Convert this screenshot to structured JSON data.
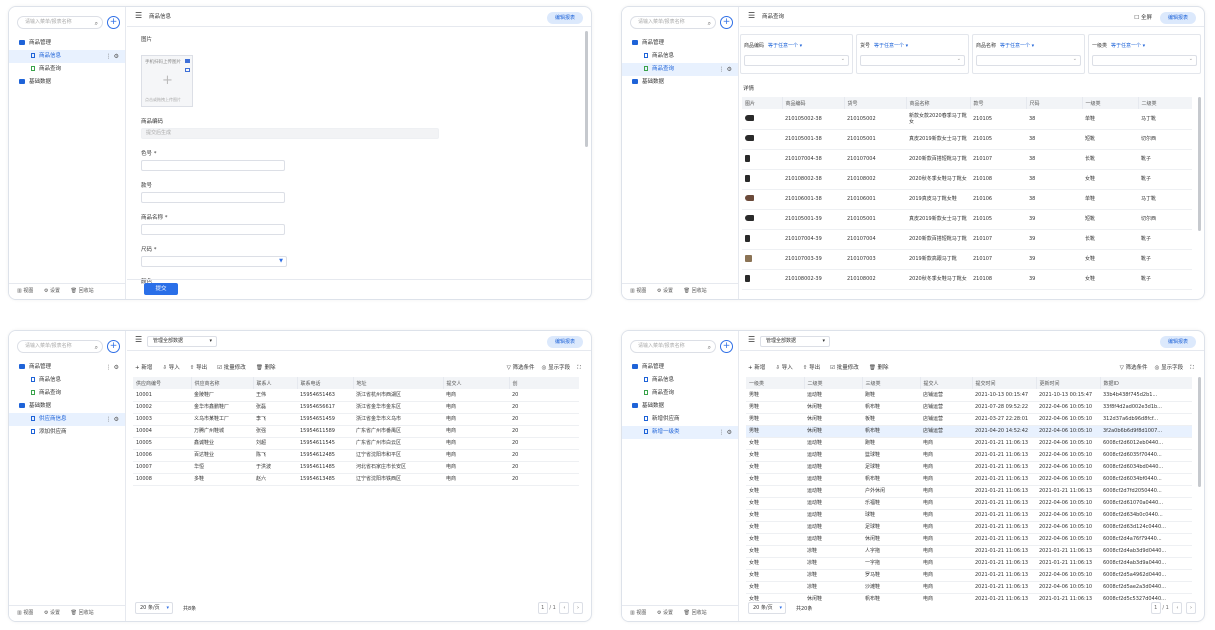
{
  "common": {
    "search_placeholder": "请输入菜单/报表名称",
    "add": "+",
    "footer": [
      "视图",
      "设置",
      "回收站"
    ]
  },
  "p1": {
    "tree": [
      {
        "label": "商品管理",
        "level": 1,
        "icon": "folder"
      },
      {
        "label": "商品信息",
        "level": 2,
        "icon": "doc",
        "selected": true
      },
      {
        "label": "商品查询",
        "level": 2,
        "icon": "doc-green"
      },
      {
        "label": "基础数据",
        "level": 1,
        "icon": "folder"
      }
    ],
    "title": "商品信息",
    "edit_btn": "编辑报表",
    "form": {
      "image_label": "图片",
      "upload_hint1": "手机扫码上传图片",
      "upload_hint2": "点击或拖拽上传图片",
      "code_label": "商品编码",
      "code_placeholder": "提交后生成",
      "color_label": "色号 *",
      "model_label": "款号",
      "name_label": "商品名称 *",
      "size_label": "尺码 *",
      "color2_label": "颜色",
      "submit": "提交"
    }
  },
  "p2": {
    "tree": [
      {
        "label": "商品管理",
        "level": 1,
        "icon": "folder"
      },
      {
        "label": "商品信息",
        "level": 2,
        "icon": "doc"
      },
      {
        "label": "商品查询",
        "level": 2,
        "icon": "doc-green",
        "selected": true
      },
      {
        "label": "基础数据",
        "level": 1,
        "icon": "folder"
      }
    ],
    "title": "商品查询",
    "fullscreen": "全屏",
    "edit_btn": "编辑报表",
    "filters": [
      {
        "name": "商品编码",
        "op": "等于任意一个"
      },
      {
        "name": "货号",
        "op": "等于任意一个"
      },
      {
        "name": "商品名称",
        "op": "等于任意一个"
      },
      {
        "name": "一级类",
        "op": "等于任意一个"
      }
    ],
    "result_label": "详情",
    "columns": [
      "图片",
      "商品编码",
      "货号",
      "商品名称",
      "款号",
      "尺码",
      "一级类",
      "二级类"
    ],
    "rows": [
      [
        "shoe",
        "210105002-38",
        "210105002",
        "新款女款2020春季马丁靴女",
        "210105",
        "38",
        "单鞋",
        "马丁靴"
      ],
      [
        "shoe",
        "210105001-38",
        "210105001",
        "真皮2019新款女士马丁靴",
        "210105",
        "38",
        "短靴",
        "切尔西"
      ],
      [
        "boot",
        "210107004-38",
        "210107004",
        "2020新款百搭短靴马丁靴",
        "210107",
        "38",
        "长靴",
        "靴子"
      ],
      [
        "boot",
        "210108002-38",
        "210108002",
        "2020秋冬季女鞋马丁靴女",
        "210108",
        "38",
        "女鞋",
        "靴子"
      ],
      [
        "shoe-brown",
        "210106001-38",
        "210106001",
        "2019真皮马丁靴女鞋",
        "210106",
        "38",
        "单鞋",
        "马丁靴"
      ],
      [
        "shoe",
        "210105001-39",
        "210105001",
        "真皮2019新款女士马丁靴",
        "210105",
        "39",
        "短靴",
        "切尔西"
      ],
      [
        "boot",
        "210107004-39",
        "210107004",
        "2020新款百搭短靴马丁靴",
        "210107",
        "39",
        "长靴",
        "靴子"
      ],
      [
        "tan",
        "210107003-39",
        "210107003",
        "2019新款高跟马丁靴",
        "210107",
        "39",
        "女鞋",
        "靴子"
      ],
      [
        "boot",
        "210108002-39",
        "210108002",
        "2020秋冬季女鞋马丁靴女",
        "210108",
        "39",
        "女鞋",
        "靴子"
      ]
    ]
  },
  "p3": {
    "tree": [
      {
        "label": "商品管理",
        "level": 1,
        "icon": "folder",
        "right": true
      },
      {
        "label": "商品信息",
        "level": 2,
        "icon": "doc"
      },
      {
        "label": "商品查询",
        "level": 2,
        "icon": "doc-green"
      },
      {
        "label": "基础数据",
        "level": 1,
        "icon": "folder"
      },
      {
        "label": "供应商信息",
        "level": 2,
        "icon": "doc",
        "selected": true
      },
      {
        "label": "添加供应商",
        "level": 2,
        "icon": "doc"
      }
    ],
    "view_select": "管理全部数据",
    "edit_btn": "编辑报表",
    "toolbar": [
      "+ 新增",
      "导入",
      "导出",
      "批量修改",
      "删除"
    ],
    "toolbar_right": [
      "筛选条件",
      "显示字段"
    ],
    "columns": [
      "供应商编号",
      "供应商名称",
      "联系人",
      "联系电话",
      "地址",
      "提交人",
      "创"
    ],
    "rows": [
      [
        "10001",
        "金陵鞋厂",
        "王伟",
        "15954651463",
        "浙江省杭州市西湖区",
        "电商",
        "20"
      ],
      [
        "10002",
        "金华市鑫鹏鞋厂",
        "张磊",
        "15954656617",
        "浙江省金华市金东区",
        "电商",
        "20"
      ],
      [
        "10003",
        "义乌市某鞋工厂",
        "李飞",
        "15954651459",
        "浙江省金华市义乌市",
        "电商",
        "20"
      ],
      [
        "10004",
        "万腾广州鞋城",
        "张强",
        "15954611589",
        "广东省广州市番禺区",
        "电商",
        "20"
      ],
      [
        "10005",
        "鑫诚鞋业",
        "刘超",
        "15954611545",
        "广东省广州市白云区",
        "电商",
        "20"
      ],
      [
        "10006",
        "百达鞋业",
        "陈飞",
        "15954612485",
        "辽宁省沈阳市和平区",
        "电商",
        "20"
      ],
      [
        "10007",
        "华恒",
        "于洪波",
        "15954611485",
        "河北省石家庄市长安区",
        "电商",
        "20"
      ],
      [
        "10008",
        "多鞋",
        "赵六",
        "15954613485",
        "辽宁省沈阳市铁西区",
        "电商",
        "20"
      ]
    ],
    "page_size": "20 条/页",
    "total": "共8条",
    "page": "1",
    "page_total": "/ 1"
  },
  "p4": {
    "tree": [
      {
        "label": "商品管理",
        "level": 1,
        "icon": "folder"
      },
      {
        "label": "商品信息",
        "level": 2,
        "icon": "doc"
      },
      {
        "label": "商品查询",
        "level": 2,
        "icon": "doc-green"
      },
      {
        "label": "基础数据",
        "level": 1,
        "icon": "folder"
      },
      {
        "label": "新增供应商",
        "level": 2,
        "icon": "doc"
      },
      {
        "label": "新增一级类",
        "level": 2,
        "icon": "doc",
        "selected": true
      }
    ],
    "view_select": "管理全部数据",
    "edit_btn": "编辑报表",
    "toolbar": [
      "+ 新增",
      "导入",
      "导出",
      "批量修改",
      "删除"
    ],
    "toolbar_right": [
      "筛选条件",
      "显示字段"
    ],
    "columns": [
      "一级类",
      "二级类",
      "三级类",
      "提交人",
      "提交时间",
      "更新时间",
      "数据ID"
    ],
    "rows": [
      [
        "男鞋",
        "运动鞋",
        "跑鞋",
        "店铺运营",
        "2021-10-13 00:15:47",
        "2021-10-13 00:15:47",
        "33b4b438f745d2b1..."
      ],
      [
        "男鞋",
        "休闲鞋",
        "帆布鞋",
        "店铺运营",
        "2021-07-28 09:52:22",
        "2022-04-06 10:05:10",
        "33f8f4d2ad002e3d1b..."
      ],
      [
        "男鞋",
        "休闲鞋",
        "板鞋",
        "店铺运营",
        "2021-03-27 22:28:01",
        "2022-04-06 10:05:10",
        "312d37a6db96d8fcf..."
      ],
      [
        "男鞋",
        "休闲鞋",
        "帆布鞋",
        "店铺运营",
        "2021-04-20 14:52:42",
        "2022-04-06 10:05:10",
        "3f2a0b6b6d9f8d1007..."
      ],
      [
        "女鞋",
        "运动鞋",
        "跑鞋",
        "电商",
        "2021-01-21 11:06:13",
        "2022-04-06 10:05:10",
        "6008cf2d6012eb0440..."
      ],
      [
        "女鞋",
        "运动鞋",
        "篮球鞋",
        "电商",
        "2021-01-21 11:06:13",
        "2022-04-06 10:05:10",
        "6008cf2d6035f70440..."
      ],
      [
        "女鞋",
        "运动鞋",
        "足球鞋",
        "电商",
        "2021-01-21 11:06:13",
        "2022-04-06 10:05:10",
        "6008cf2d6034bd0440..."
      ],
      [
        "女鞋",
        "运动鞋",
        "帆布鞋",
        "电商",
        "2021-01-21 11:06:13",
        "2022-04-06 10:05:10",
        "6008cf2d6034bf0440..."
      ],
      [
        "女鞋",
        "运动鞋",
        "户外休闲",
        "电商",
        "2021-01-21 11:06:13",
        "2021-01-21 11:06:13",
        "6008cf2d7fd2050440..."
      ],
      [
        "女鞋",
        "运动鞋",
        "乐福鞋",
        "电商",
        "2021-01-21 11:06:13",
        "2022-04-06 10:05:10",
        "6008cf2d61070a0440..."
      ],
      [
        "女鞋",
        "运动鞋",
        "球鞋",
        "电商",
        "2021-01-21 11:06:13",
        "2022-04-06 10:05:10",
        "6008cf2d634b0c0440..."
      ],
      [
        "女鞋",
        "运动鞋",
        "足球鞋",
        "电商",
        "2021-01-21 11:06:13",
        "2022-04-06 10:05:10",
        "6008cf2d63d124c0440..."
      ],
      [
        "女鞋",
        "运动鞋",
        "休闲鞋",
        "电商",
        "2021-01-21 11:06:13",
        "2022-04-06 10:05:10",
        "6008cf2d4a76f79440..."
      ],
      [
        "女鞋",
        "凉鞋",
        "人字拖",
        "电商",
        "2021-01-21 11:06:13",
        "2021-01-21 11:06:13",
        "6008cf2d4ab3d9d0440..."
      ],
      [
        "女鞋",
        "凉鞋",
        "一字拖",
        "电商",
        "2021-01-21 11:06:13",
        "2021-01-21 11:06:13",
        "6008cf2d4ab3d9a0440..."
      ],
      [
        "女鞋",
        "凉鞋",
        "罗马鞋",
        "电商",
        "2021-01-21 11:06:13",
        "2022-04-06 10:05:10",
        "6008cf2d5a4962d0440..."
      ],
      [
        "女鞋",
        "凉鞋",
        "沙滩鞋",
        "电商",
        "2021-01-21 11:06:13",
        "2022-04-06 10:05:10",
        "6008cf2d5ae2a3d0440..."
      ],
      [
        "女鞋",
        "休闲鞋",
        "帆布鞋",
        "电商",
        "2021-01-21 11:06:13",
        "2021-01-21 11:06:13",
        "6008cf2d5c5327d0440..."
      ]
    ],
    "page_size": "20 条/页",
    "total": "共20条",
    "page": "1",
    "page_total": "/ 1"
  }
}
